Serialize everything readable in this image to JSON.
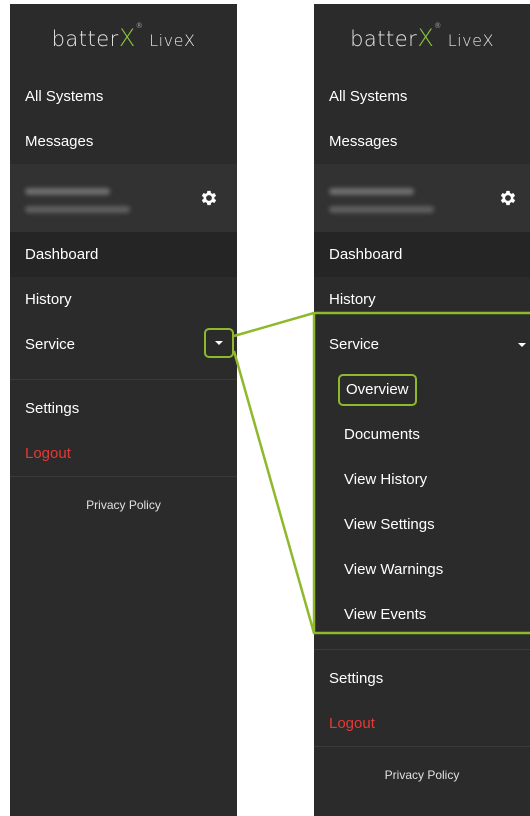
{
  "logo": {
    "brand": "batter",
    "x": "X",
    "reg": "®",
    "live": "LiveX"
  },
  "menu": {
    "all_systems": "All Systems",
    "messages": "Messages",
    "dashboard": "Dashboard",
    "history": "History",
    "service": "Service",
    "settings": "Settings",
    "logout": "Logout",
    "privacy": "Privacy Policy"
  },
  "service_submenu": [
    "Overview",
    "Documents",
    "View History",
    "View Settings",
    "View Warnings",
    "View Events"
  ],
  "colors": {
    "panel_bg": "#2b2b2b",
    "accent_green": "#8bc53f",
    "highlight_green": "#8fb82c",
    "logout_red": "#e53935"
  },
  "icons": {
    "settings": "gear-icon",
    "expand": "chevron-down-icon"
  }
}
